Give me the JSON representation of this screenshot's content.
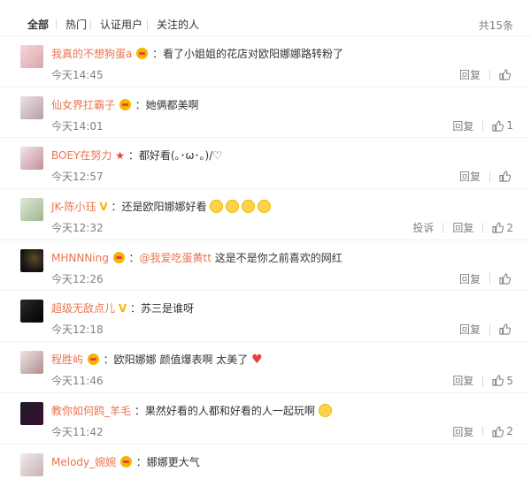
{
  "filter": {
    "tabs": [
      "全部",
      "热门",
      "认证用户",
      "关注的人"
    ],
    "total": "共15条"
  },
  "actions": {
    "reply": "回复",
    "report": "投诉"
  },
  "comments": [
    {
      "user": "我真的不想狗蛋a",
      "text": "：看了小姐姐的花店对欧阳娜娜路转粉了",
      "time": "今天14:45",
      "likes": ""
    },
    {
      "user": "仙女界扛霸子",
      "text": "：她俩都美啊",
      "time": "今天14:01",
      "likes": "1"
    },
    {
      "user": "BOEY在努力",
      "text": "：都好看(｡･ω･｡)/♡",
      "time": "今天12:57",
      "likes": ""
    },
    {
      "user": "JK-陈小珏",
      "text": "：还是欧阳娜娜好看",
      "time": "今天12:32",
      "likes": "2"
    },
    {
      "user": "MHNNNing",
      "mention": "@我爱吃蛋黄tt",
      "text": " 这是不是你之前喜欢的网红",
      "time": "今天12:26",
      "likes": ""
    },
    {
      "user": "超级无敌点儿",
      "text": "：苏三是谁呀",
      "time": "今天12:18",
      "likes": ""
    },
    {
      "user": "程胜屿",
      "text": "：欧阳娜娜 颜值爆表啊 太美了",
      "time": "今天11:46",
      "likes": "5"
    },
    {
      "user": "教你如何鸥_羊毛",
      "text": "：果然好看的人都和好看的人一起玩啊",
      "time": "今天11:42",
      "likes": "2"
    },
    {
      "user": "Melody_婉婉",
      "text": "：娜娜更大气",
      "time": "",
      "likes": ""
    }
  ]
}
